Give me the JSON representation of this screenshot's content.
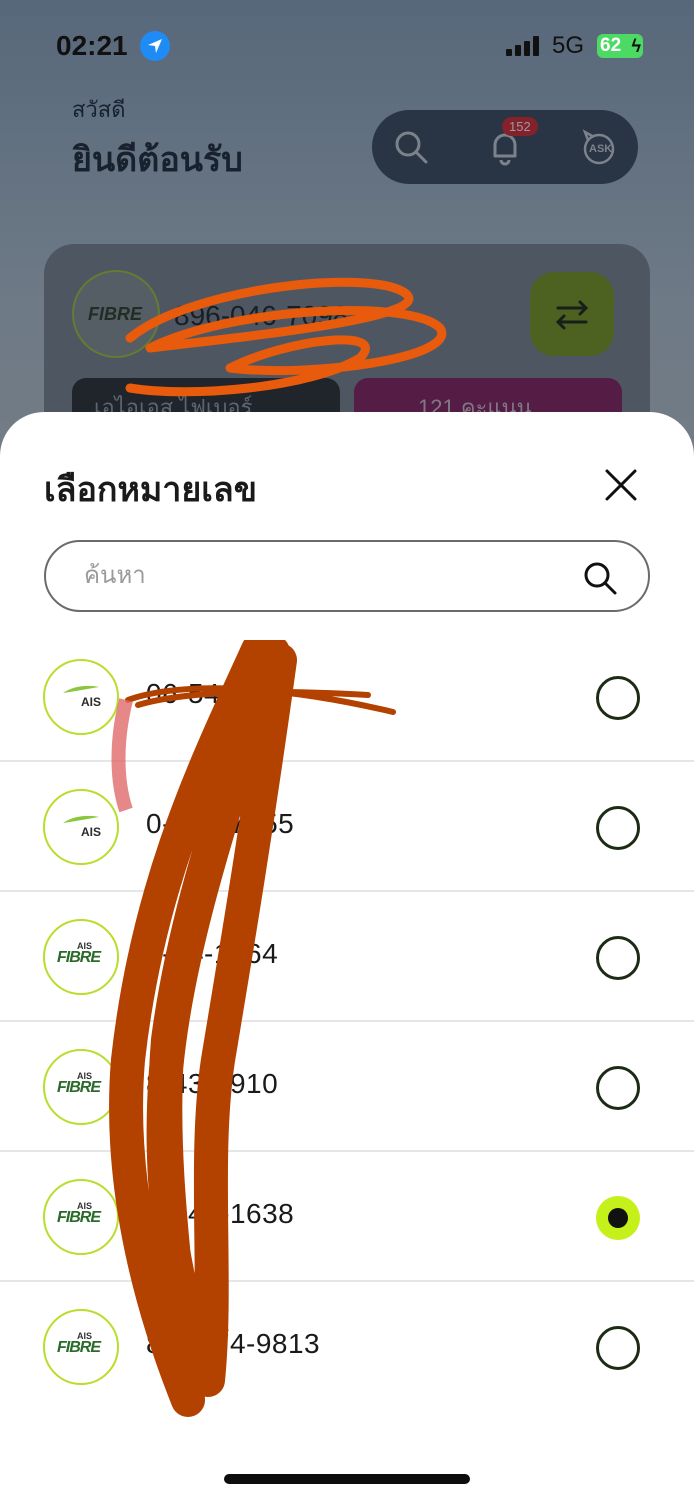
{
  "status_bar": {
    "time": "02:21",
    "network": "5G",
    "battery": "62"
  },
  "header": {
    "greeting_small": "สวัสดี",
    "greeting_big": "ยินดีต้อนรับ",
    "notification_count": "152",
    "ask_label": "ASK"
  },
  "account_card": {
    "number": "896-046-7098",
    "pill_left": "เอไอเอส ไฟเบอร์",
    "pill_right": "121 คะแนน"
  },
  "sheet": {
    "title": "เลือกหมายเลข",
    "search_placeholder": "ค้นหา",
    "items": [
      {
        "type": "AIS",
        "number": "06-5498",
        "selected": false
      },
      {
        "type": "AIS",
        "number": "0-716-7755",
        "selected": false
      },
      {
        "type": "FIBRE",
        "number": "8-54-1964",
        "selected": false
      },
      {
        "type": "FIBRE",
        "number": "8-43-1910",
        "selected": false
      },
      {
        "type": "FIBRE",
        "number": "0-546-1638",
        "selected": true
      },
      {
        "type": "FIBRE",
        "number": "8-0-574-9813",
        "selected": false
      }
    ]
  },
  "brand_labels": {
    "ais": "AIS",
    "fibre": "FIBRE"
  },
  "colors": {
    "accent": "#c5f01a",
    "logo_ring": "#b9dd2b",
    "redaction": "#b34100"
  }
}
